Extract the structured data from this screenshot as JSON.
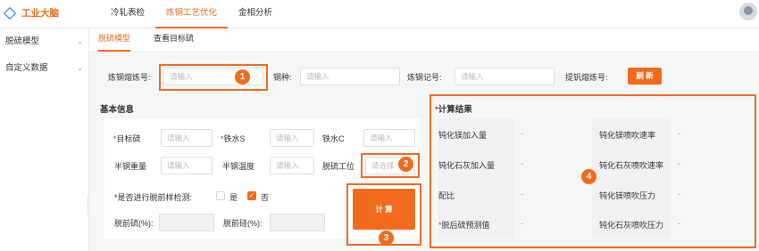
{
  "app": {
    "logo_text": "工业大脑"
  },
  "topnav": {
    "items": [
      "冷轧表检",
      "炼钢工艺优化",
      "金相分析"
    ]
  },
  "sidebar": {
    "items": [
      "脱硫模型",
      "自定义数据"
    ]
  },
  "subtabs": [
    "脱硫模型",
    "查看目标硫"
  ],
  "form_top": {
    "heat_no_label": "炼钢熔炼号:",
    "heat_no_placeholder": "请输入",
    "steel_type_label": "钢种:",
    "steel_type_placeholder": "请输入",
    "steel_mark_label": "炼钢记号:",
    "steel_mark_placeholder": "请输入",
    "fetch_heat_label": "提钒熔炼号:",
    "refresh_label": "刷 新"
  },
  "basic_info": {
    "title": "基本信息",
    "target_s_label": "目标硫",
    "target_s_placeholder": "请输入",
    "iron_s_label": "铁水S",
    "iron_s_placeholder": "请输入",
    "iron_c_label": "铁水C",
    "iron_c_placeholder": "请输入",
    "half_steel_weight_label": "半钢重量",
    "half_steel_weight_placeholder": "请输入",
    "half_steel_temp_label": "半钢温度",
    "half_steel_temp_placeholder": "请输入",
    "desulf_station_label": "脱硫工位",
    "desulf_station_placeholder": "请选择",
    "sample_check_label": "*是否进行脱前样检测:",
    "yes_label": "是",
    "no_label": "否",
    "pre_s_label": "脱前硫(%):",
    "pre_si_label": "脱前硅(%):",
    "calc_label": "计 算"
  },
  "result": {
    "title": "计算结果",
    "rows": [
      {
        "left_label": "钝化镁加入量",
        "left_value": "-",
        "right_label": "钝化镁喷吹速率",
        "right_value": "-"
      },
      {
        "left_label": "钝化石灰加入量",
        "left_value": "-",
        "right_label": "钝化石灰喷吹速率",
        "right_value": "-"
      },
      {
        "left_label": "配比",
        "left_value": "-",
        "right_label": "钝化镁喷吹压力",
        "right_value": "-"
      },
      {
        "left_label": "脱后硫预测值",
        "left_value": "-",
        "right_label": "钝化石灰喷吹压力",
        "right_value": "-"
      }
    ]
  },
  "callouts": [
    "1",
    "2",
    "3",
    "4"
  ],
  "colors": {
    "accent": "#f26b1d",
    "background": "#f5f6f8"
  }
}
